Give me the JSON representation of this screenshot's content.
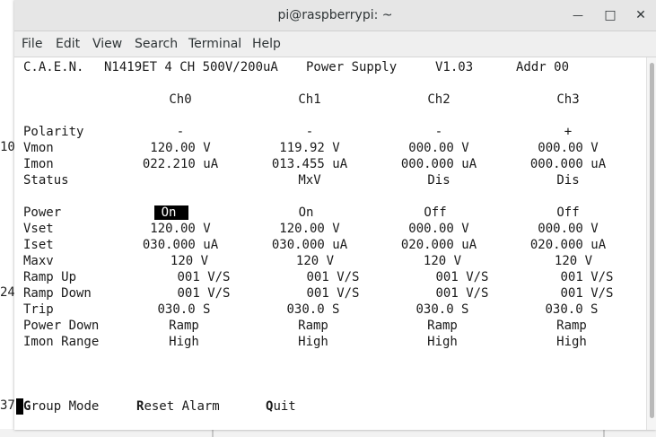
{
  "window": {
    "title": "pi@raspberrypi: ~",
    "minimize_glyph": "—",
    "maximize_glyph": "□",
    "close_glyph": "✕"
  },
  "menubar": {
    "items": [
      "File",
      "Edit",
      "View",
      "Search",
      "Terminal",
      "Help"
    ]
  },
  "background": {
    "left_fragments": [
      "10",
      "24",
      "37"
    ]
  },
  "terminal": {
    "header": {
      "maker": "C.A.E.N.",
      "model": "N1419ET 4 CH 500V/200uA",
      "product": "Power Supply",
      "version": "V1.03",
      "addr": "Addr 00"
    },
    "channels": [
      "Ch0",
      "Ch1",
      "Ch2",
      "Ch3"
    ],
    "monitor_rows": [
      {
        "label": "Polarity",
        "values": [
          "-",
          "-",
          "-",
          "+"
        ]
      },
      {
        "label": "Vmon",
        "values": [
          "120.00 V",
          "119.92 V",
          "000.00 V",
          "000.00 V"
        ]
      },
      {
        "label": "Imon",
        "values": [
          "022.210 uA",
          "013.455 uA",
          "000.000 uA",
          "000.000 uA"
        ]
      },
      {
        "label": "Status",
        "values": [
          "",
          "MxV",
          "Dis",
          "Dis"
        ]
      }
    ],
    "settings_rows": [
      {
        "label": "Power",
        "values": [
          "On",
          "On",
          "Off",
          "Off"
        ]
      },
      {
        "label": "Vset",
        "values": [
          "120.00 V",
          "120.00 V",
          "000.00 V",
          "000.00 V"
        ]
      },
      {
        "label": "Iset",
        "values": [
          "030.000 uA",
          "030.000 uA",
          "020.000 uA",
          "020.000 uA"
        ]
      },
      {
        "label": "Maxv",
        "values": [
          "120 V",
          "120 V",
          "120 V",
          "120 V"
        ]
      },
      {
        "label": "Ramp Up",
        "values": [
          "001 V/S",
          "001 V/S",
          "001 V/S",
          "001 V/S"
        ]
      },
      {
        "label": "Ramp Down",
        "values": [
          "001 V/S",
          "001 V/S",
          "001 V/S",
          "001 V/S"
        ]
      },
      {
        "label": "Trip",
        "values": [
          "030.0 S",
          "030.0 S",
          "030.0 S",
          "030.0 S"
        ]
      },
      {
        "label": "Power Down",
        "values": [
          "Ramp",
          "Ramp",
          "Ramp",
          "Ramp"
        ]
      },
      {
        "label": "Imon Range",
        "values": [
          "High",
          "High",
          "High",
          "High"
        ]
      }
    ],
    "footer": {
      "group_key": "G",
      "group_rest": "roup Mode",
      "reset_key": "R",
      "reset_rest": "eset Alarm",
      "quit_key": "Q",
      "quit_rest": "uit"
    }
  }
}
